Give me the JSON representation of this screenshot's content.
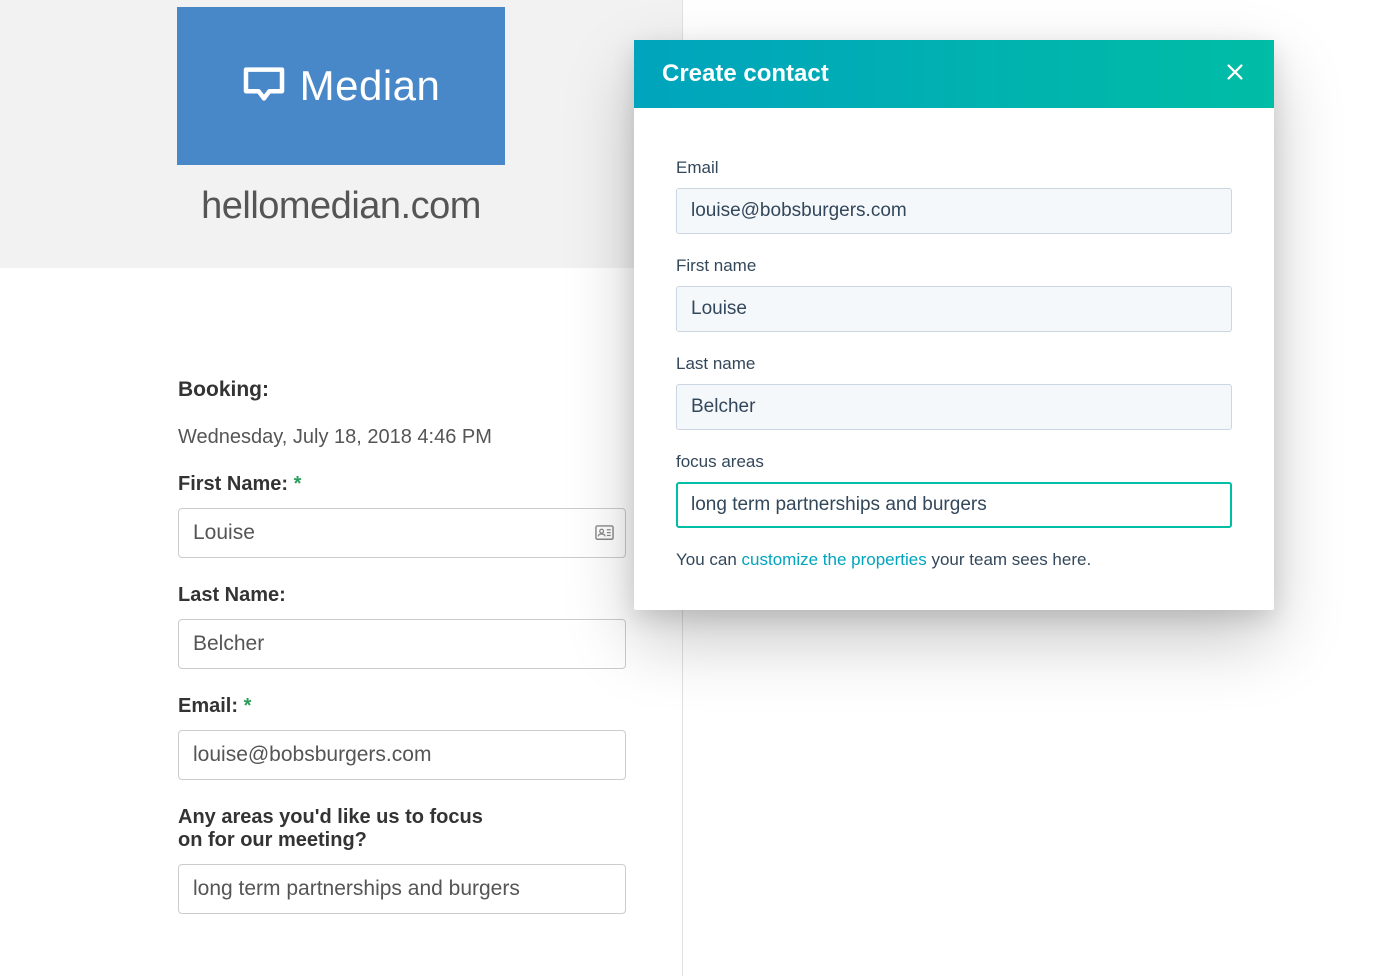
{
  "brand": {
    "name": "Median",
    "url": "hellomedian.com"
  },
  "booking": {
    "section_label": "Booking:",
    "datetime": "Wednesday, July 18, 2018 4:46 PM",
    "fields": {
      "first_name": {
        "label": "First Name:",
        "required": true,
        "value": "Louise"
      },
      "last_name": {
        "label": "Last Name:",
        "required": false,
        "value": "Belcher"
      },
      "email": {
        "label": "Email:",
        "required": true,
        "value": "louise@bobsburgers.com"
      },
      "focus_question": {
        "label": "Any areas you'd like us to focus on for our meeting?",
        "required": false,
        "value": "long term partnerships and burgers"
      }
    },
    "required_marker": "*"
  },
  "modal": {
    "title": "Create contact",
    "fields": {
      "email": {
        "label": "Email",
        "value": "louise@bobsburgers.com"
      },
      "first_name": {
        "label": "First name",
        "value": "Louise"
      },
      "last_name": {
        "label": "Last name",
        "value": "Belcher"
      },
      "focus_areas": {
        "label": "focus areas",
        "value": "long term partnerships and burgers"
      }
    },
    "footer": {
      "prefix": "You can ",
      "link": "customize the properties",
      "suffix": " your team sees here."
    }
  }
}
